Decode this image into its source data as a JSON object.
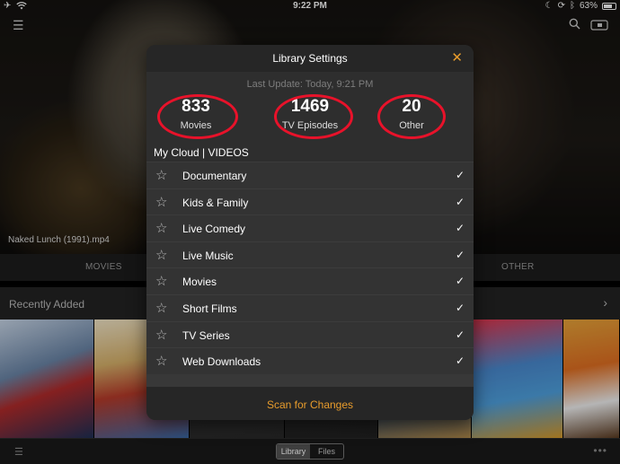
{
  "status_bar": {
    "time": "9:22 PM",
    "battery": "63%"
  },
  "hero": {
    "caption": "Naked Lunch (1991).mp4"
  },
  "tabs": [
    "MOVIES",
    "OTHER"
  ],
  "recent": {
    "label": "Recently Added"
  },
  "bottom_bar": {
    "library_label": "Library",
    "files_label": "Files"
  },
  "modal": {
    "title": "Library Settings",
    "last_update": "Last Update: Today, 9:21 PM",
    "stats": [
      {
        "value": "833",
        "label": "Movies"
      },
      {
        "value": "1469",
        "label": "TV Episodes"
      },
      {
        "value": "20",
        "label": "Other"
      }
    ],
    "section_title": "My Cloud | VIDEOS",
    "folders": [
      {
        "label": "Documentary",
        "checked": true
      },
      {
        "label": "Kids & Family",
        "checked": true
      },
      {
        "label": "Live Comedy",
        "checked": true
      },
      {
        "label": "Live Music",
        "checked": true
      },
      {
        "label": "Movies",
        "checked": true
      },
      {
        "label": "Short Films",
        "checked": true
      },
      {
        "label": "TV Series",
        "checked": true
      },
      {
        "label": "Web Downloads",
        "checked": true
      }
    ],
    "scan_label": "Scan for Changes"
  },
  "colors": {
    "accent": "#e89c2c",
    "highlight_ring": "#e8122a"
  },
  "icons": {
    "airplane": "airplane-icon",
    "wifi": "wifi-icon",
    "menu": "hamburger-icon",
    "search": "search-icon",
    "cast": "cast-icon",
    "star": "star-outline-icon",
    "check": "checkmark-icon",
    "close": "close-icon",
    "chevron": "chevron-right-icon"
  }
}
